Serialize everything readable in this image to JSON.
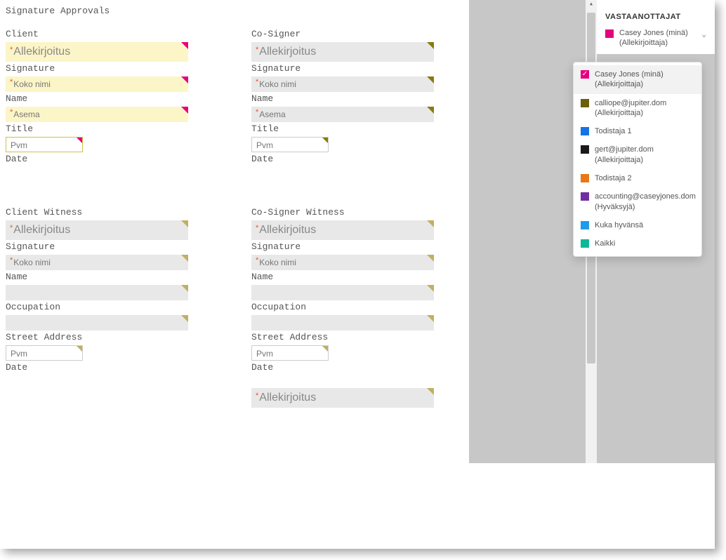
{
  "title": "Signature Approvals",
  "columns": {
    "client": {
      "header": "Client",
      "fields": {
        "signature": {
          "label": "Allekirjoitus",
          "caption": "Signature"
        },
        "name": {
          "label": "Koko nimi",
          "caption": "Name"
        },
        "title": {
          "label": "Asema",
          "caption": "Title"
        },
        "date": {
          "label": "Pvm",
          "caption": "Date"
        }
      }
    },
    "cosigner": {
      "header": "Co-Signer",
      "fields": {
        "signature": {
          "label": "Allekirjoitus",
          "caption": "Signature"
        },
        "name": {
          "label": "Koko nimi",
          "caption": "Name"
        },
        "title": {
          "label": "Asema",
          "caption": "Title"
        },
        "date": {
          "label": "Pvm",
          "caption": "Date"
        }
      }
    },
    "client_witness": {
      "header": "Client Witness",
      "fields": {
        "signature": {
          "label": "Allekirjoitus",
          "caption": "Signature"
        },
        "name": {
          "label": "Koko nimi",
          "caption": "Name"
        },
        "blank": {
          "label": "",
          "caption": ""
        },
        "occupation": {
          "label": "",
          "caption": "Occupation"
        },
        "street": {
          "label": "",
          "caption": "Street Address"
        },
        "date": {
          "label": "Pvm",
          "caption": "Date"
        }
      }
    },
    "cosigner_witness": {
      "header": "Co-Signer Witness",
      "fields": {
        "signature": {
          "label": "Allekirjoitus",
          "caption": "Signature"
        },
        "name": {
          "label": "Koko nimi",
          "caption": "Name"
        },
        "blank": {
          "label": "",
          "caption": ""
        },
        "occupation": {
          "label": "",
          "caption": "Occupation"
        },
        "street": {
          "label": "",
          "caption": "Street Address"
        },
        "date": {
          "label": "Pvm",
          "caption": "Date"
        },
        "extra_signature": {
          "label": "Allekirjoitus"
        }
      }
    }
  },
  "sidebar": {
    "header": "VASTAANOTTAJAT",
    "current": {
      "name": "Casey Jones (minä)",
      "role": "(Allekirjoittaja)"
    }
  },
  "dropdown": [
    {
      "name": "Casey Jones (minä)",
      "role": "(Allekirjoittaja)",
      "color": "sw-magenta",
      "selected": true
    },
    {
      "name": "calliope@jupiter.dom",
      "role": "(Allekirjoittaja)",
      "color": "sw-olive",
      "selected": false
    },
    {
      "name": "Todistaja 1",
      "role": "",
      "color": "sw-blue",
      "selected": false
    },
    {
      "name": "gert@jupiter.dom",
      "role": "(Allekirjoittaja)",
      "color": "sw-black",
      "selected": false
    },
    {
      "name": "Todistaja 2",
      "role": "",
      "color": "sw-orange",
      "selected": false
    },
    {
      "name": "accounting@caseyjones.dom",
      "role": "(Hyväksyjä)",
      "color": "sw-purple",
      "selected": false
    },
    {
      "name": "Kuka hyvänsä",
      "role": "",
      "color": "sw-lblue",
      "selected": false
    },
    {
      "name": "Kaikki",
      "role": "",
      "color": "sw-teal",
      "selected": false
    }
  ]
}
